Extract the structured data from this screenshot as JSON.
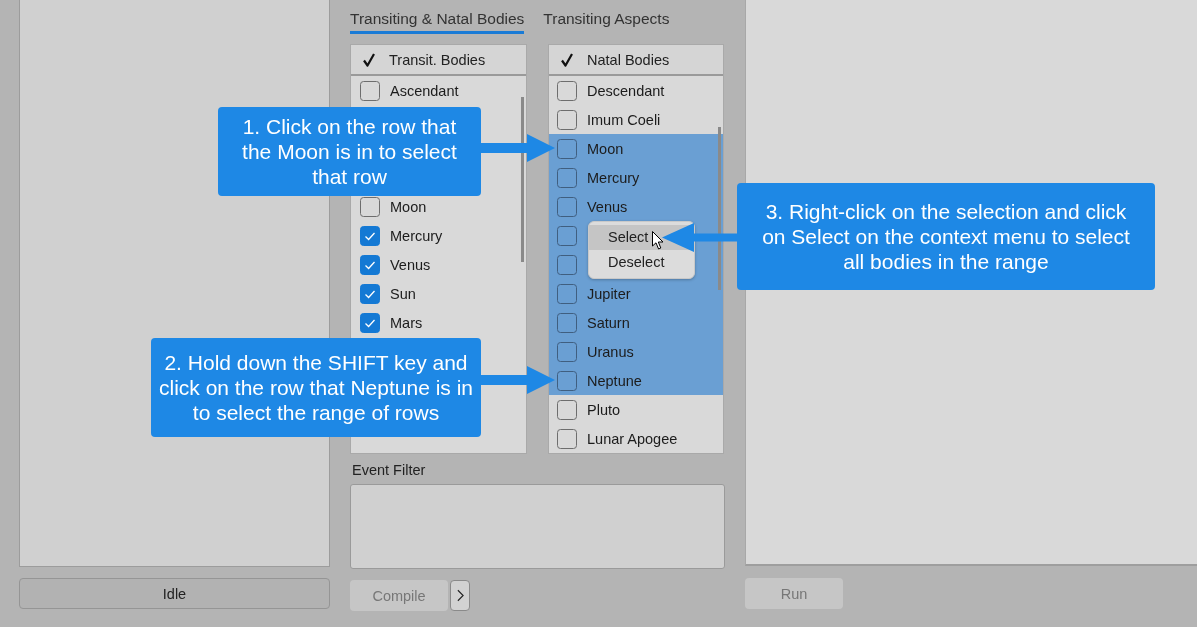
{
  "side_panel": {
    "status_button": {
      "label": "Idle",
      "disabled": false
    }
  },
  "tabs": [
    {
      "label": "Transiting & Natal Bodies",
      "selected": true
    },
    {
      "label": "Transiting Aspects",
      "selected": false
    }
  ],
  "transit_list": {
    "header": "Transit. Bodies",
    "rows": [
      {
        "label": "Ascendant",
        "checked": false,
        "selected": false
      },
      {
        "label": "Moon",
        "checked": false,
        "selected": false
      },
      {
        "label": "Mercury",
        "checked": true,
        "selected": false
      },
      {
        "label": "Venus",
        "checked": true,
        "selected": false
      },
      {
        "label": "Sun",
        "checked": true,
        "selected": false
      },
      {
        "label": "Mars",
        "checked": true,
        "selected": false
      }
    ]
  },
  "natal_list": {
    "header": "Natal Bodies",
    "rows": [
      {
        "label": "Descendant",
        "checked": false,
        "selected": false
      },
      {
        "label": "Imum Coeli",
        "checked": false,
        "selected": false
      },
      {
        "label": "Moon",
        "checked": false,
        "selected": true
      },
      {
        "label": "Mercury",
        "checked": false,
        "selected": true
      },
      {
        "label": "Venus",
        "checked": false,
        "selected": true
      },
      {
        "checked": false,
        "selected": true
      },
      {
        "checked": false,
        "selected": true
      },
      {
        "label": "Jupiter",
        "checked": false,
        "selected": true
      },
      {
        "label": "Saturn",
        "checked": false,
        "selected": true
      },
      {
        "label": "Uranus",
        "checked": false,
        "selected": true
      },
      {
        "label": "Neptune",
        "checked": false,
        "selected": true
      },
      {
        "label": "Pluto",
        "checked": false,
        "selected": false
      },
      {
        "label": "Lunar Apogee",
        "checked": false,
        "selected": false
      }
    ]
  },
  "context_menu": {
    "items": [
      {
        "label": "Select",
        "highlighted": true
      },
      {
        "label": "Deselect",
        "highlighted": false
      }
    ]
  },
  "event_filter": {
    "label": "Event Filter"
  },
  "compile_button": {
    "label": "Compile",
    "disabled": true
  },
  "run_button": {
    "label": "Run",
    "disabled": true
  },
  "callouts": [
    {
      "text": "1. Click on the row that the Moon is in to select that row"
    },
    {
      "text": "2. Hold down the SHIFT key and click on the row that Neptune is in to select the range of rows"
    },
    {
      "text": "3. Right-click on the selection and click on Select on the context menu to select all bodies in the range"
    }
  ]
}
